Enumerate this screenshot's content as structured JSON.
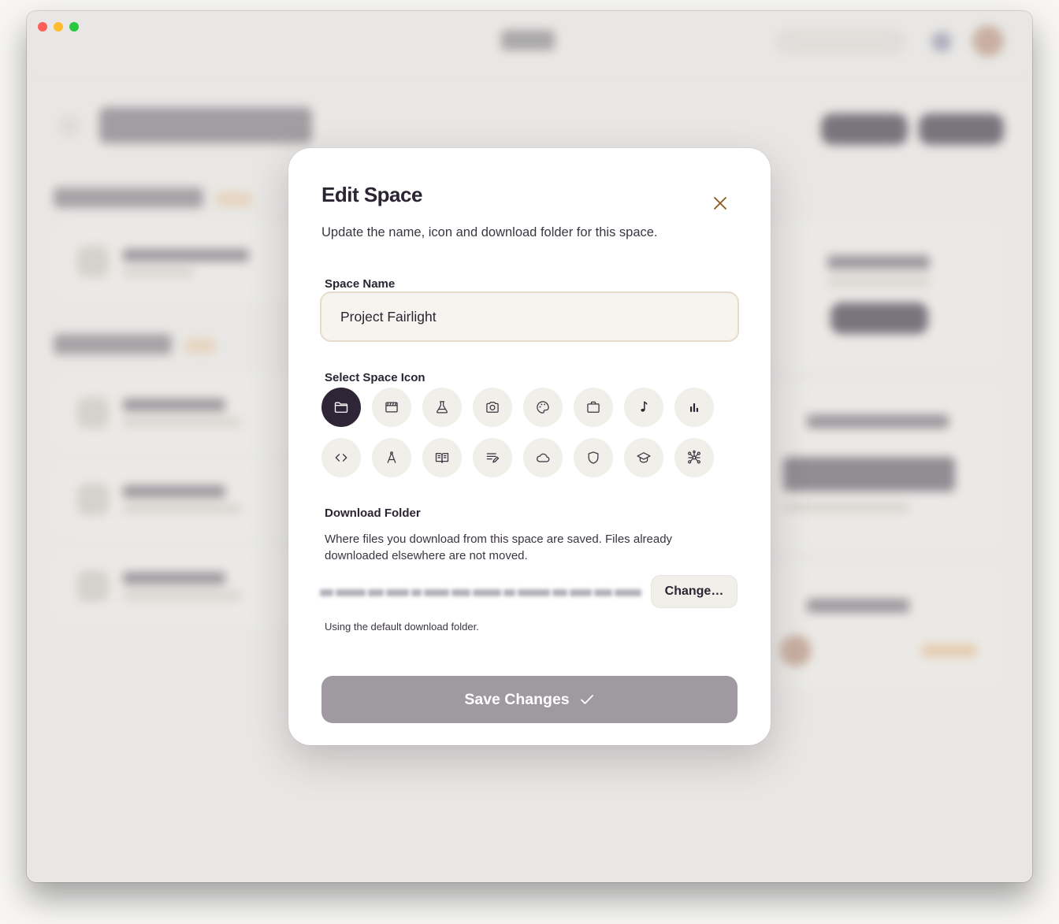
{
  "modal": {
    "title": "Edit Space",
    "subtitle": "Update the name, icon and download folder for this space.",
    "space_name_label": "Space Name",
    "space_name_value": "Project Fairlight",
    "icon_label": "Select Space Icon",
    "icons": [
      {
        "name": "folder-icon",
        "selected": true
      },
      {
        "name": "clapperboard-icon",
        "selected": false
      },
      {
        "name": "flask-icon",
        "selected": false
      },
      {
        "name": "camera-icon",
        "selected": false
      },
      {
        "name": "palette-icon",
        "selected": false
      },
      {
        "name": "briefcase-icon",
        "selected": false
      },
      {
        "name": "music-note-icon",
        "selected": false
      },
      {
        "name": "bar-chart-icon",
        "selected": false
      },
      {
        "name": "code-icon",
        "selected": false
      },
      {
        "name": "compass-icon",
        "selected": false
      },
      {
        "name": "open-book-icon",
        "selected": false
      },
      {
        "name": "notes-pencil-icon",
        "selected": false
      },
      {
        "name": "cloud-icon",
        "selected": false
      },
      {
        "name": "shield-icon",
        "selected": false
      },
      {
        "name": "graduation-cap-icon",
        "selected": false
      },
      {
        "name": "network-icon",
        "selected": false
      }
    ],
    "download_label": "Download Folder",
    "download_desc": "Where files you download from this space are saved. Files already downloaded elsewhere are not moved.",
    "change_label": "Change…",
    "download_note": "Using the default download folder.",
    "save_label": "Save Changes"
  },
  "colors": {
    "accent_dark": "#2e2536",
    "save_disabled": "#9e9aa0",
    "input_border": "#e6dccb",
    "close_icon": "#8a5a1c"
  }
}
